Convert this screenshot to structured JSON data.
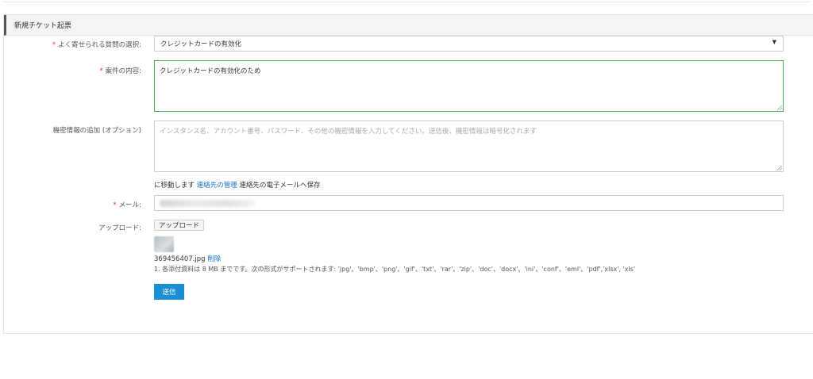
{
  "panel": {
    "title": "新規チケット起票"
  },
  "form": {
    "faq": {
      "required_mark": "*",
      "label": "よく寄せられる質問の選択:",
      "value": "クレジットカードの有効化",
      "caret": "▼"
    },
    "content": {
      "required_mark": "*",
      "label": "案件の内容:",
      "value": "クレジットカードの有効化のため"
    },
    "secret": {
      "label": "機密情報の追加 (オプション)",
      "placeholder": "インスタンス名、アカウント番号、パスワード、その他の機密情報を入力してください。送信後、機密情報は暗号化されます"
    },
    "contact_info": {
      "prefix": "に移動します",
      "link": "連絡先の管理",
      "suffix": "連絡先の電子メールへ保存"
    },
    "email": {
      "required_mark": "*",
      "label": "メール:"
    },
    "upload": {
      "label": "アップロード:",
      "button": "アップロード",
      "file_name": "369456407.jpg",
      "delete_link": "削除",
      "note": "1. 各添付資料は 8 MB までです。次の形式がサポートされます: 'jpg'、'bmp'、'png'、'gif'、'txt'、'rar'、'zip'、'doc'、'docx'、'ini'、'conf'、'eml'、'pdf','xlsx', 'xls'"
    },
    "submit": "送信"
  }
}
